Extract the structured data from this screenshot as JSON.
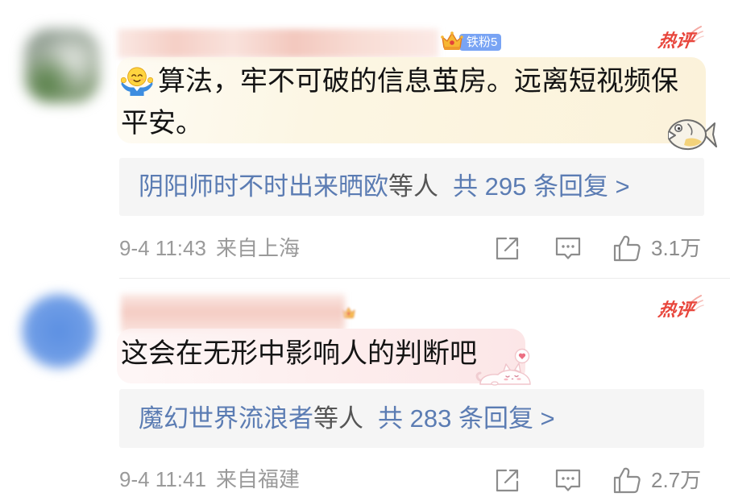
{
  "colors": {
    "link": "#5b7cb3",
    "reply_suffix": "#555555",
    "meta_text": "#9a9a9a",
    "hot_tag": "#e8463c",
    "badge_bg": "#79a4f4",
    "reply_bg": "#f5f5f5",
    "icon": "#8c8c8c",
    "text": "#141414"
  },
  "comments": [
    {
      "hot_tag": "热评",
      "badge": {
        "icon": "crown-icon",
        "label": "铁粉5"
      },
      "content": {
        "emoji": "shrug-emoji-icon",
        "text": "算法，牢不可破的信息茧房。远离短视频保平安。",
        "sticker": "fish-sticker-icon"
      },
      "replies": {
        "users": "阴阳师时不时出来晒欧",
        "suffix": "等人",
        "count_text": "共 295 条回复 >"
      },
      "meta": {
        "time": "9-4 11:43",
        "location": "来自上海"
      },
      "actions": {
        "share_icon": "share-icon",
        "comment_icon": "comment-icon",
        "like_icon": "like-icon",
        "like_count": "3.1万"
      }
    },
    {
      "hot_tag": "热评",
      "badge": {
        "icon": "crown-icon"
      },
      "content": {
        "text": "这会在无形中影响人的判断吧",
        "sticker": "cat-sticker-icon"
      },
      "replies": {
        "users": "魔幻世界流浪者",
        "suffix": "等人",
        "count_text": "共 283 条回复 >"
      },
      "meta": {
        "time": "9-4 11:41",
        "location": "来自福建"
      },
      "actions": {
        "share_icon": "share-icon",
        "comment_icon": "comment-icon",
        "like_icon": "like-icon",
        "like_count": "2.7万"
      }
    }
  ]
}
